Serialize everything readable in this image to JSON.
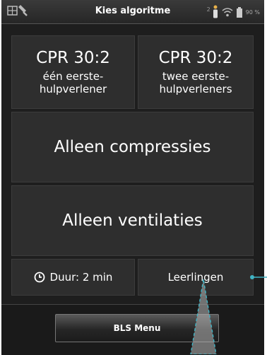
{
  "statusbar": {
    "title": "Kies algoritme",
    "users_count": "2",
    "battery_pct": "90 %",
    "icons": [
      "tools-icon",
      "person-icon",
      "wifi-icon",
      "battery-icon"
    ]
  },
  "options": {
    "cpr_single": {
      "main": "CPR 30:2",
      "line1": "één eerste-",
      "line2": "hulpverlener"
    },
    "cpr_double": {
      "main": "CPR 30:2",
      "line1": "twee eerste-",
      "line2": "hulpverleners"
    },
    "compressions_only": "Alleen compressies",
    "ventilations_only": "Alleen ventilaties"
  },
  "duration": {
    "label": "Duur: 2 min",
    "icon": "clock-icon"
  },
  "students": {
    "label": "Leerlingen"
  },
  "bls_menu": {
    "label": "BLS Menu"
  },
  "colors": {
    "annotation": "#40b4c4",
    "background": "#1e1e1e",
    "panel": "#2e2e2e"
  }
}
